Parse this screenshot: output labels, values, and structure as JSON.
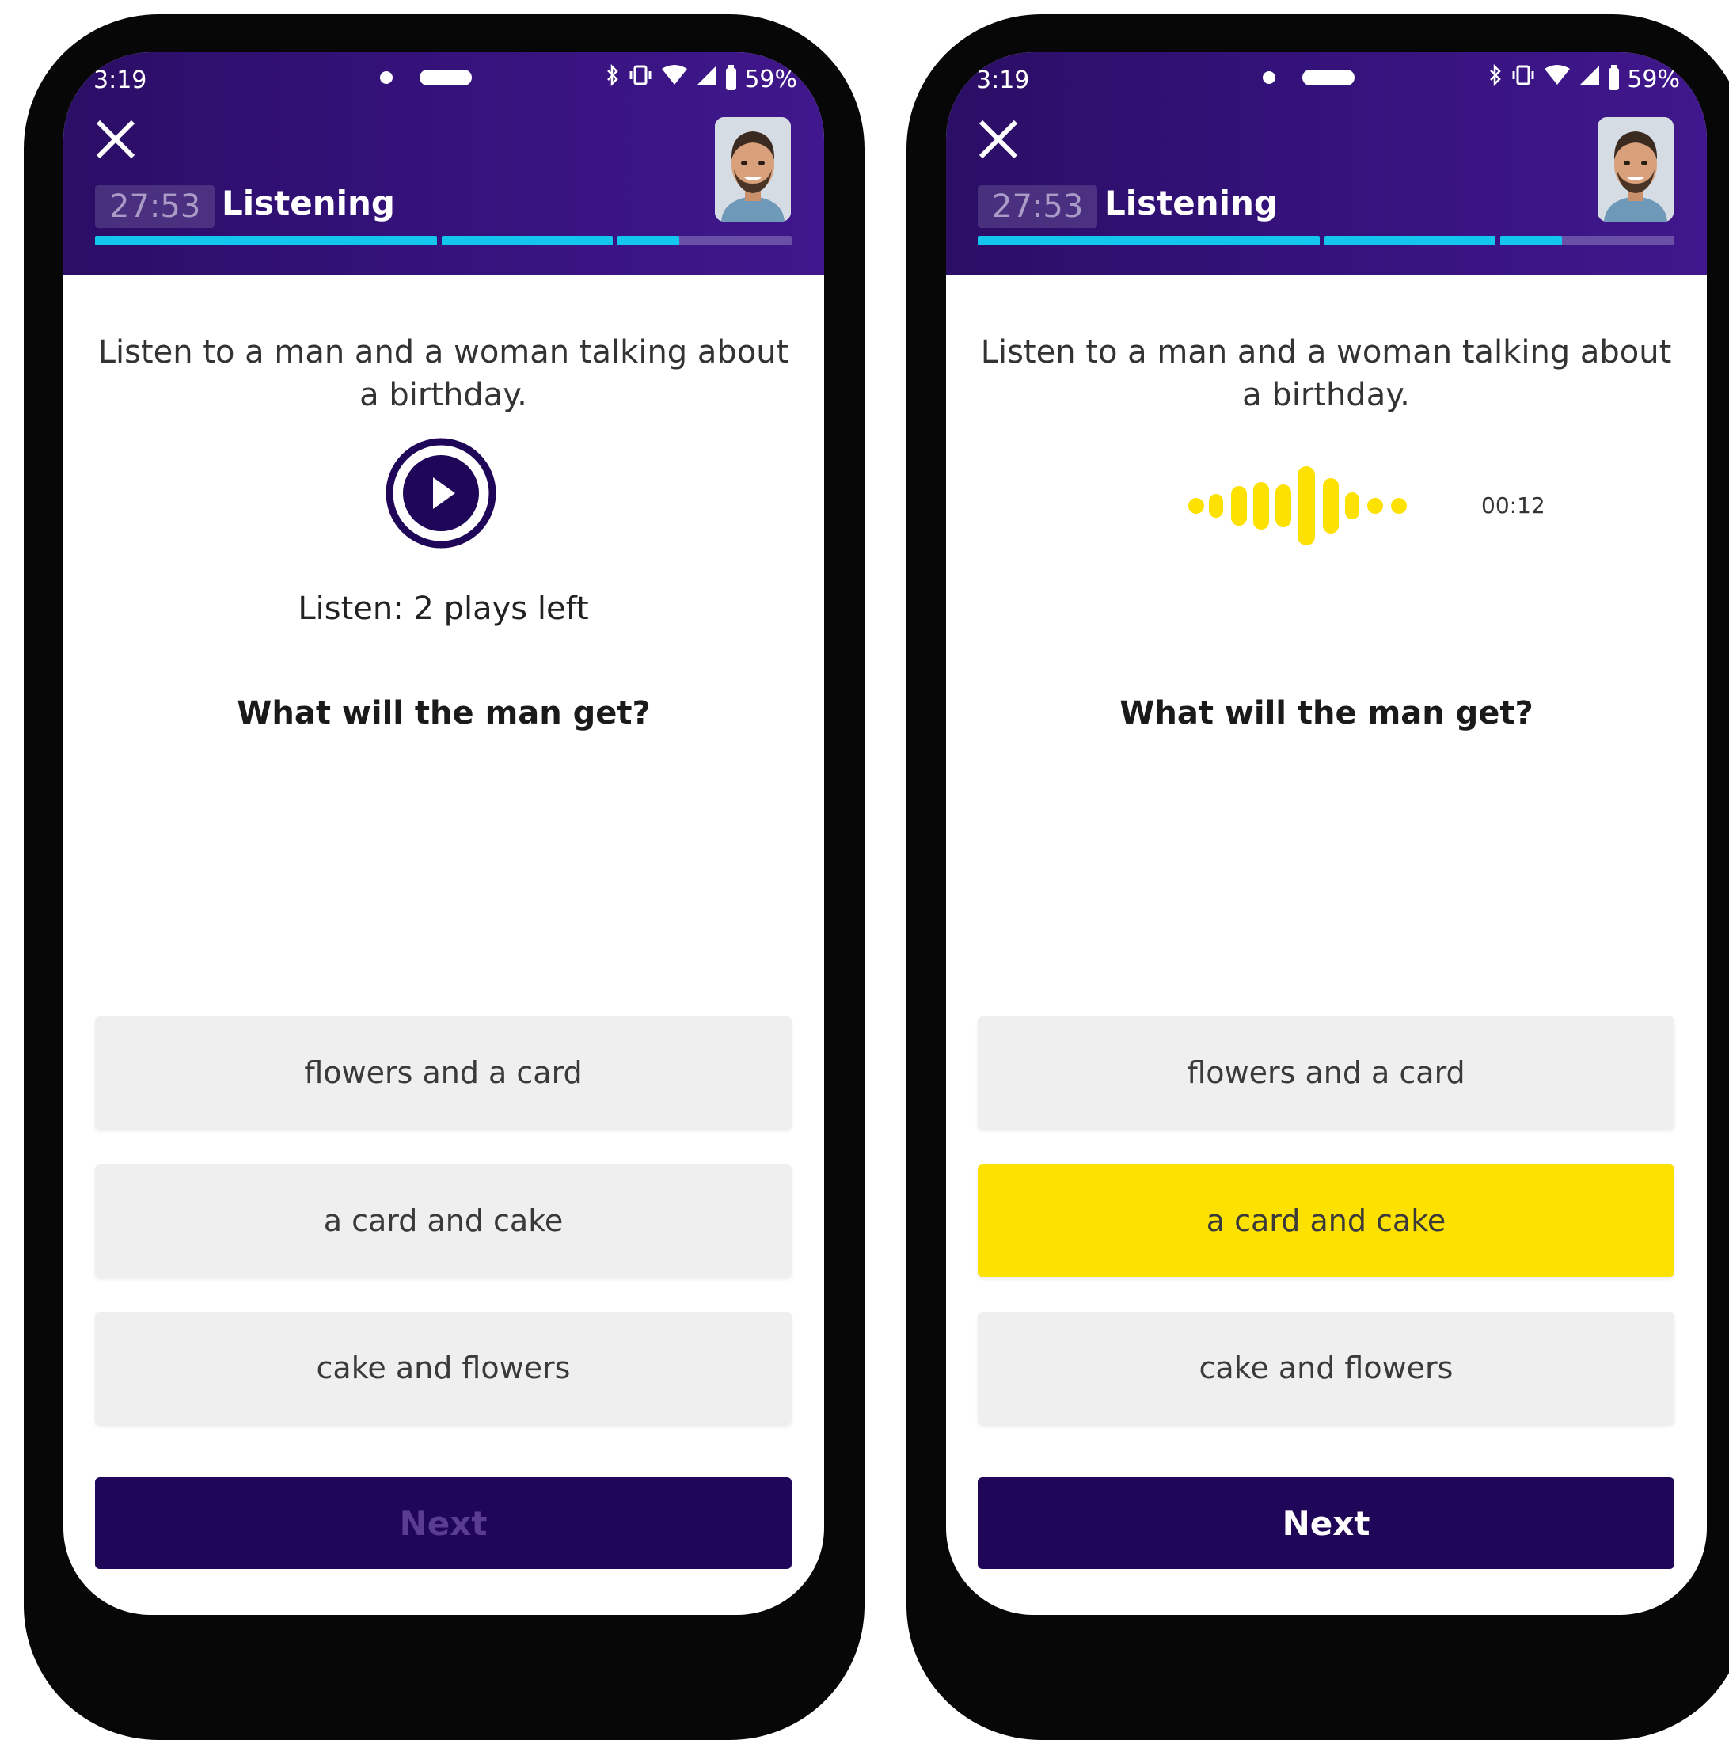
{
  "status_bar": {
    "time": "3:19",
    "battery": "59%"
  },
  "header": {
    "timer": "27:53",
    "title": "Listening"
  },
  "progress": {
    "segments": [
      1.0,
      1.0,
      0.35,
      0.0
    ]
  },
  "prompt": {
    "instruction": "Listen to a man and a woman talking about a birthday."
  },
  "player_left": {
    "plays_left": "Listen: 2 plays left"
  },
  "player_right": {
    "elapsed": "00:12"
  },
  "question": {
    "text": "What will the man get?"
  },
  "options": [
    {
      "label": "flowers and a card"
    },
    {
      "label": "a card and cake"
    },
    {
      "label": "cake and flowers"
    }
  ],
  "selected_option_right": 1,
  "next": {
    "label": "Next"
  },
  "colors": {
    "brand_purple": "#2b0e66",
    "button_purple": "#200658",
    "progress_cyan": "#12c6ee",
    "selection_yellow": "#fde100",
    "wave_yellow": "#fde100"
  },
  "icons": {
    "close": "close-icon",
    "play": "play-icon",
    "bluetooth": "bluetooth-icon",
    "vibrate": "vibrate-icon",
    "wifi": "wifi-icon",
    "signal": "signal-icon",
    "battery": "battery-icon"
  }
}
